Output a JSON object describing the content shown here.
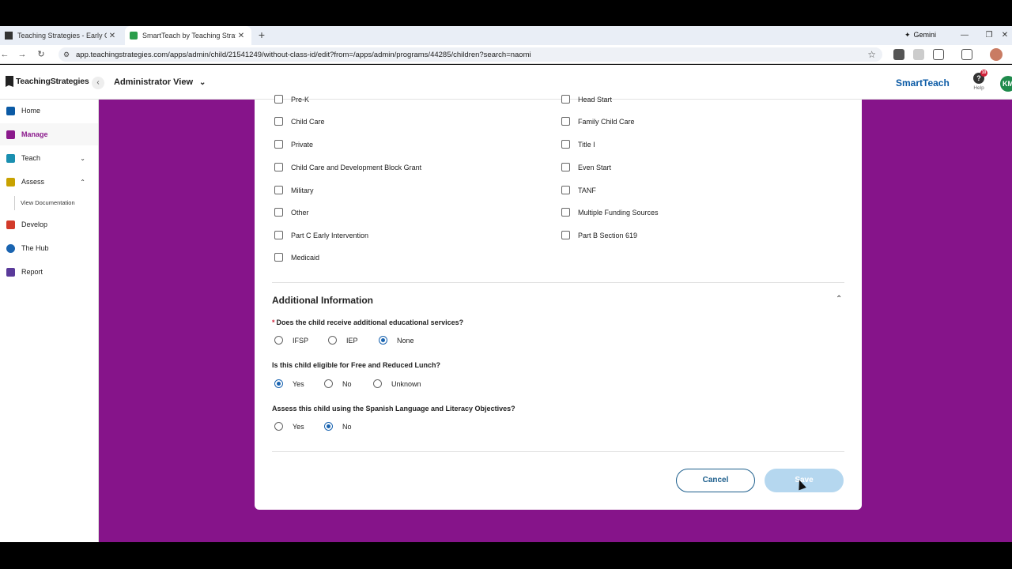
{
  "browser": {
    "tabs": [
      {
        "title": "Teaching Strategies - Early Chil",
        "active": false
      },
      {
        "title": "SmartTeach by Teaching Strate",
        "active": true
      }
    ],
    "gemini_label": "Gemini",
    "url": "app.teachingstrategies.com/apps/admin/child/21541249/without-class-id/edit?from=/apps/admin/programs/44285/children?search=naomi"
  },
  "header": {
    "logo_text": "TeachingStrategies",
    "view_label": "Administrator View",
    "brand": "SmartTeach",
    "help_label": "Help",
    "help_badge": "10",
    "avatar_initials": "KM"
  },
  "sidebar": {
    "items": [
      {
        "label": "Home",
        "color": "#0b5aa5"
      },
      {
        "label": "Manage",
        "color": "#8b1a8c"
      },
      {
        "label": "Teach",
        "color": "#1a8fb0"
      },
      {
        "label": "Assess",
        "color": "#c8a200"
      },
      {
        "label": "Develop",
        "color": "#d23a2a"
      },
      {
        "label": "The Hub",
        "color": "#1a64b0"
      },
      {
        "label": "Report",
        "color": "#5a3a9a"
      }
    ],
    "sub_item": "View Documentation"
  },
  "funding": {
    "left": [
      "Pre-K",
      "Child Care",
      "Private",
      "Child Care and Development Block Grant",
      "Military",
      "Other",
      "Part C Early Intervention",
      "Medicaid"
    ],
    "right": [
      "Head Start",
      "Family Child Care",
      "Title I",
      "Even Start",
      "TANF",
      "Multiple Funding Sources",
      "Part B Section 619"
    ]
  },
  "additional": {
    "title": "Additional Information",
    "q1": {
      "label": "Does the child receive additional educational services?",
      "required": "*",
      "options": [
        "IFSP",
        "IEP",
        "None"
      ],
      "selected": "None"
    },
    "q2": {
      "label": "Is this child eligible for Free and Reduced Lunch?",
      "options": [
        "Yes",
        "No",
        "Unknown"
      ],
      "selected": "Yes"
    },
    "q3": {
      "label": "Assess this child using the Spanish Language and Literacy Objectives?",
      "options": [
        "Yes",
        "No"
      ],
      "selected": "No"
    }
  },
  "actions": {
    "cancel": "Cancel",
    "save": "Save"
  }
}
